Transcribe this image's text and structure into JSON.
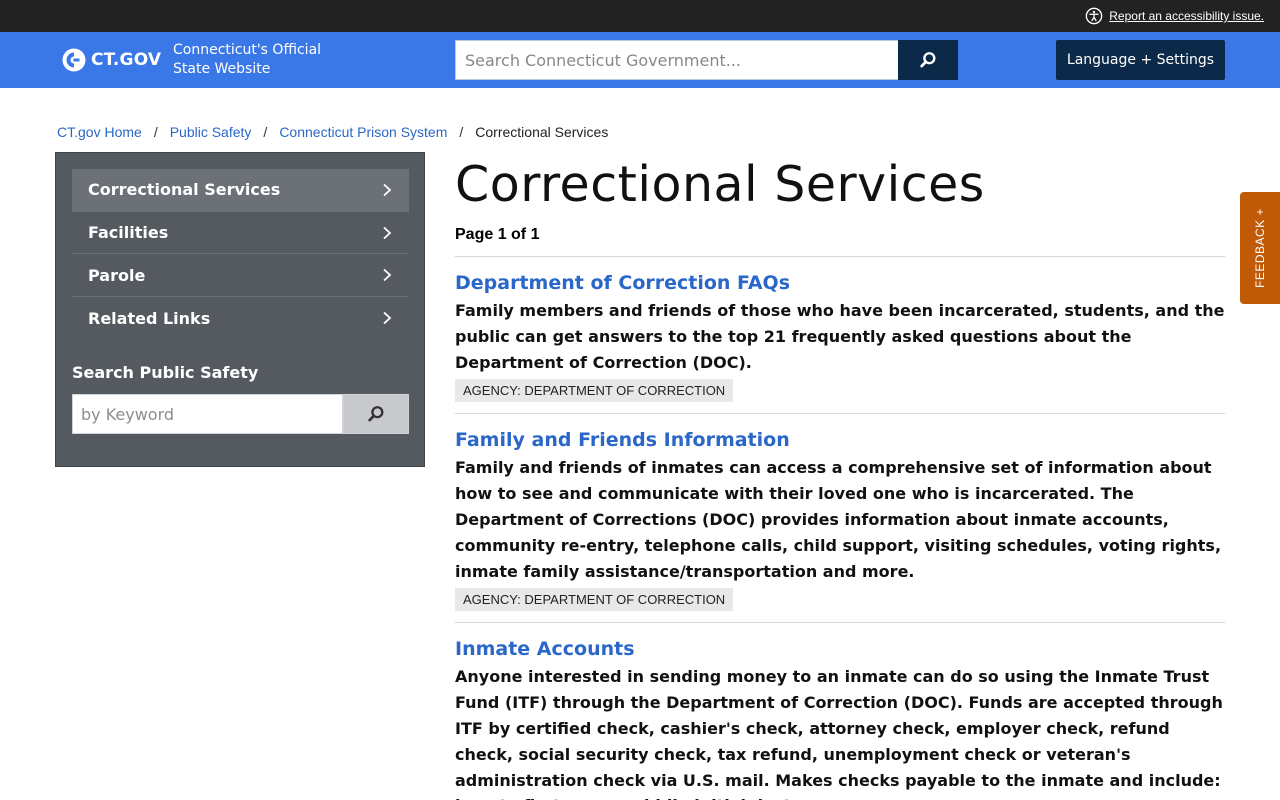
{
  "topbar": {
    "accessibility_link": "Report an accessibility issue."
  },
  "header": {
    "logo_text": "CT.GOV",
    "tagline_line1": "Connecticut's Official",
    "tagline_line2": "State Website",
    "search_placeholder": "Search Connecticut Government...",
    "language_button": "Language + Settings"
  },
  "breadcrumb": [
    "CT.gov Home",
    "Public Safety",
    "Connecticut Prison System",
    "Correctional Services"
  ],
  "sidebar": {
    "items": [
      {
        "label": "Correctional Services"
      },
      {
        "label": "Facilities"
      },
      {
        "label": "Parole"
      },
      {
        "label": "Related Links"
      }
    ],
    "search_title": "Search Public Safety",
    "search_placeholder": "by Keyword"
  },
  "main": {
    "title": "Correctional Services",
    "page_count": "Page 1 of 1",
    "results": [
      {
        "title": "Department of Correction FAQs",
        "description": "Family members and friends of those who have been incarcerated, students, and the public can get answers to the top 21 frequently asked questions about the Department of Correction (DOC).",
        "tag": "AGENCY: DEPARTMENT OF CORRECTION"
      },
      {
        "title": "Family and Friends Information",
        "description": "Family and friends of inmates can access a comprehensive set of information about how to see and communicate with their loved one who is incarcerated. The Department of Corrections (DOC) provides information about inmate accounts, community re-entry, telephone calls, child support, visiting schedules, voting rights, inmate family assistance/transportation and more.",
        "tag": "AGENCY: DEPARTMENT OF CORRECTION"
      },
      {
        "title": "Inmate Accounts",
        "description": "Anyone interested in sending money to an inmate can do so using the Inmate Trust Fund (ITF) through the Department of Correction (DOC). Funds are accepted through ITF by certified check, cashier's check, attorney check, employer check, refund check, social security check, tax refund, unemployment check or veteran's administration check via U.S. mail. Makes checks payable to the inmate and include: inmate first name, middle initial, last",
        "tag": ""
      }
    ]
  },
  "feedback": "FEEDBACK +",
  "colors": {
    "header_blue": "#3b78e7",
    "navy": "#0b2a4a",
    "link_blue": "#2a67c8",
    "sidebar_gray": "#555a60",
    "feedback_orange": "#c05a06"
  }
}
